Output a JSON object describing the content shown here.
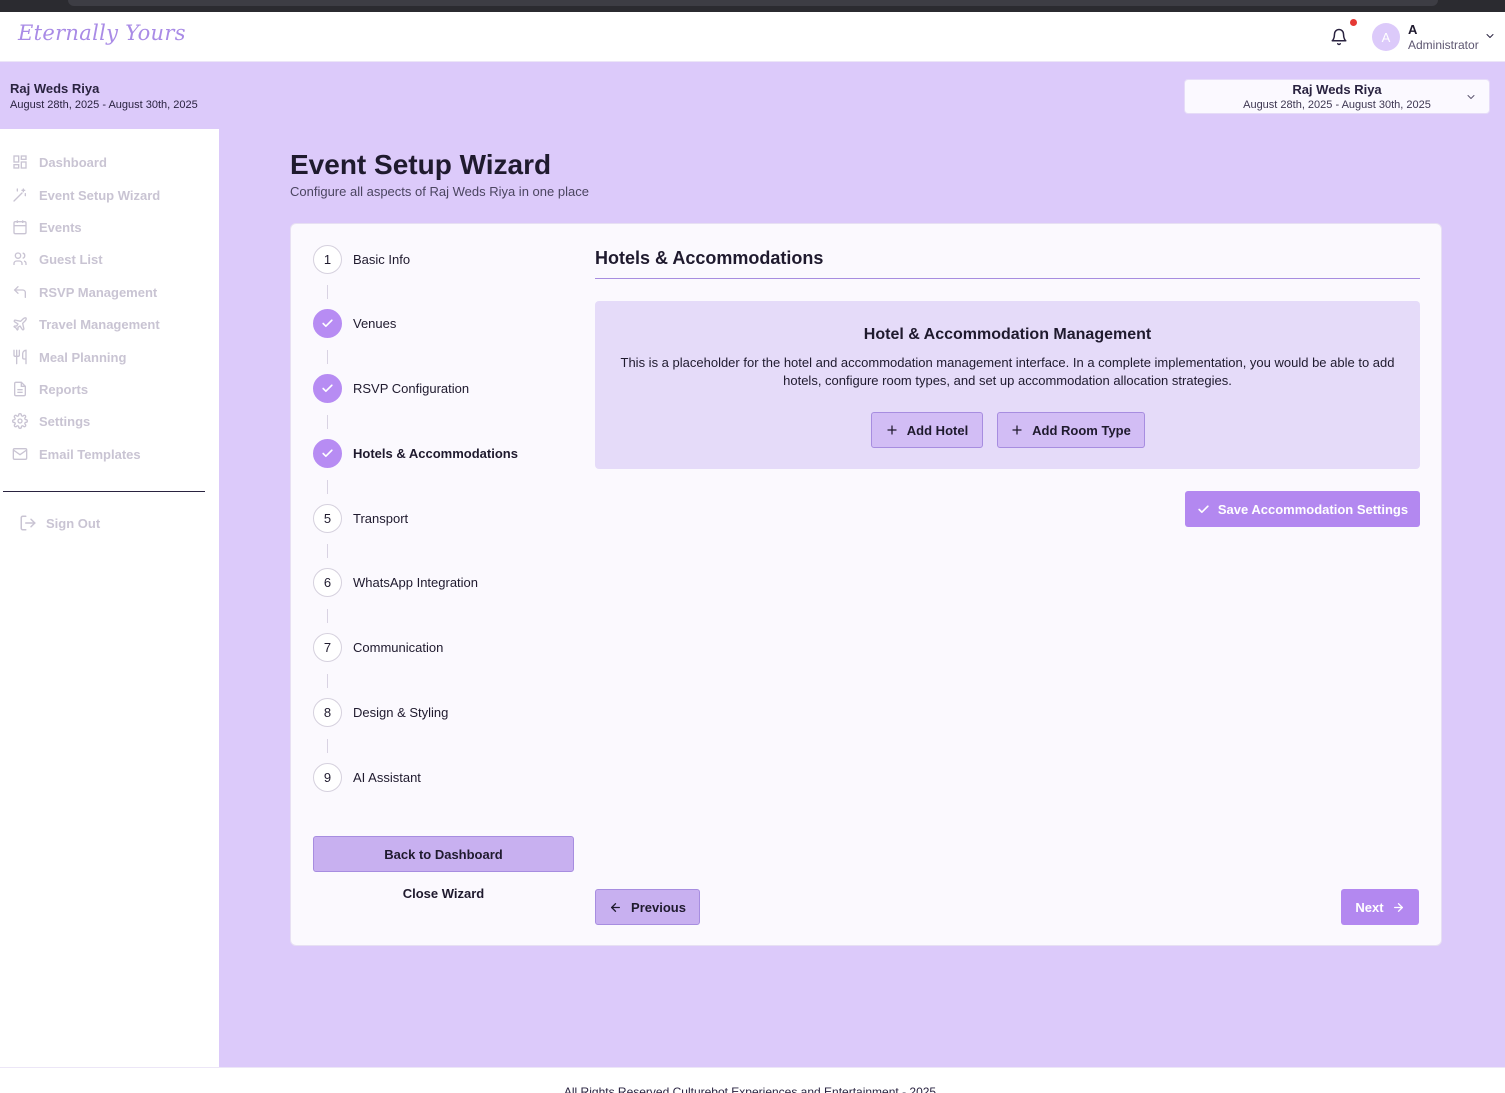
{
  "colors": {
    "accent": "#b388f0",
    "page_background": "#dccafa",
    "logo": "#a98be6",
    "notification_dot": "#e53935",
    "nav_muted": "#c9c4d3"
  },
  "header": {
    "logo_text": "Eternally Yours",
    "user_initial": "A",
    "user_name": "A",
    "user_role": "Administrator"
  },
  "event": {
    "name": "Raj Weds Riya",
    "dates": "August 28th, 2025 - August 30th, 2025"
  },
  "event_selector": {
    "name": "Raj Weds Riya",
    "dates": "August 28th, 2025 - August 30th, 2025"
  },
  "sidebar": {
    "items": [
      {
        "label": "Dashboard",
        "icon": "dashboard-icon"
      },
      {
        "label": "Event Setup Wizard",
        "icon": "magic-wand-icon"
      },
      {
        "label": "Events",
        "icon": "calendar-icon"
      },
      {
        "label": "Guest List",
        "icon": "users-icon"
      },
      {
        "label": "RSVP Management",
        "icon": "reply-icon"
      },
      {
        "label": "Travel Management",
        "icon": "plane-icon"
      },
      {
        "label": "Meal Planning",
        "icon": "utensils-icon"
      },
      {
        "label": "Reports",
        "icon": "document-icon"
      },
      {
        "label": "Settings",
        "icon": "gear-icon"
      },
      {
        "label": "Email Templates",
        "icon": "mail-icon"
      }
    ],
    "sign_out": "Sign Out"
  },
  "page": {
    "title": "Event Setup Wizard",
    "subtitle": "Configure all aspects of Raj Weds Riya in one place"
  },
  "wizard": {
    "steps": [
      {
        "number": "1",
        "label": "Basic Info",
        "status": "pending"
      },
      {
        "number": "2",
        "label": "Venues",
        "status": "complete"
      },
      {
        "number": "3",
        "label": "RSVP Configuration",
        "status": "complete"
      },
      {
        "number": "4",
        "label": "Hotels & Accommodations",
        "status": "complete-active"
      },
      {
        "number": "5",
        "label": "Transport",
        "status": "pending"
      },
      {
        "number": "6",
        "label": "WhatsApp Integration",
        "status": "pending"
      },
      {
        "number": "7",
        "label": "Communication",
        "status": "pending"
      },
      {
        "number": "8",
        "label": "Design & Styling",
        "status": "pending"
      },
      {
        "number": "9",
        "label": "AI Assistant",
        "status": "pending"
      }
    ],
    "back_to_dashboard": "Back to Dashboard",
    "close_wizard": "Close Wizard"
  },
  "content": {
    "section_title": "Hotels & Accommodations",
    "panel_title": "Hotel & Accommodation Management",
    "panel_text": "This is a placeholder for the hotel and accommodation management interface. In a complete implementation, you would be able to add hotels, configure room types, and set up accommodation allocation strategies.",
    "add_hotel": "Add Hotel",
    "add_room_type": "Add Room Type",
    "save_settings": "Save Accommodation Settings",
    "previous": "Previous",
    "next": "Next"
  },
  "footer": {
    "text": "All Rights Reserved Culturebot Experiences and Entertainment - 2025"
  }
}
